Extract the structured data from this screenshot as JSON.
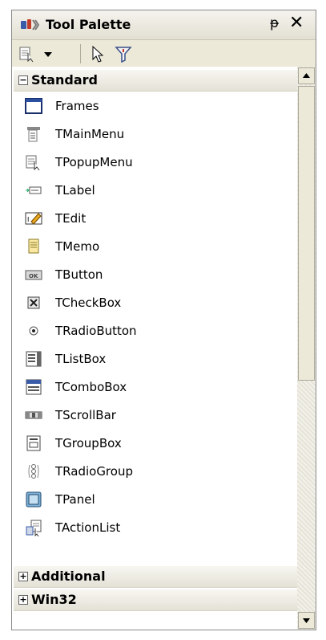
{
  "window": {
    "title": "Tool Palette",
    "pin_glyph": "ᵽ",
    "close_glyph": "✕"
  },
  "toolbar": {
    "buttons": [
      "categories-dropdown-icon",
      "dropdown-arrow-icon",
      "pointer-icon",
      "filter-icon"
    ]
  },
  "categories": {
    "standard": {
      "label": "Standard",
      "expander": "−"
    },
    "additional": {
      "label": "Additional",
      "expander": "+"
    },
    "win32": {
      "label": "Win32",
      "expander": "+"
    }
  },
  "items": [
    {
      "label": "Frames",
      "icon": "frames-icon"
    },
    {
      "label": "TMainMenu",
      "icon": "main-menu-icon"
    },
    {
      "label": "TPopupMenu",
      "icon": "popup-menu-icon"
    },
    {
      "label": "TLabel",
      "icon": "label-icon"
    },
    {
      "label": "TEdit",
      "icon": "edit-icon"
    },
    {
      "label": "TMemo",
      "icon": "memo-icon"
    },
    {
      "label": "TButton",
      "icon": "button-icon"
    },
    {
      "label": "TCheckBox",
      "icon": "checkbox-icon"
    },
    {
      "label": "TRadioButton",
      "icon": "radio-button-icon"
    },
    {
      "label": "TListBox",
      "icon": "listbox-icon"
    },
    {
      "label": "TComboBox",
      "icon": "combobox-icon"
    },
    {
      "label": "TScrollBar",
      "icon": "scrollbar-icon"
    },
    {
      "label": "TGroupBox",
      "icon": "groupbox-icon"
    },
    {
      "label": "TRadioGroup",
      "icon": "radio-group-icon"
    },
    {
      "label": "TPanel",
      "icon": "panel-icon"
    },
    {
      "label": "TActionList",
      "icon": "action-list-icon"
    }
  ]
}
